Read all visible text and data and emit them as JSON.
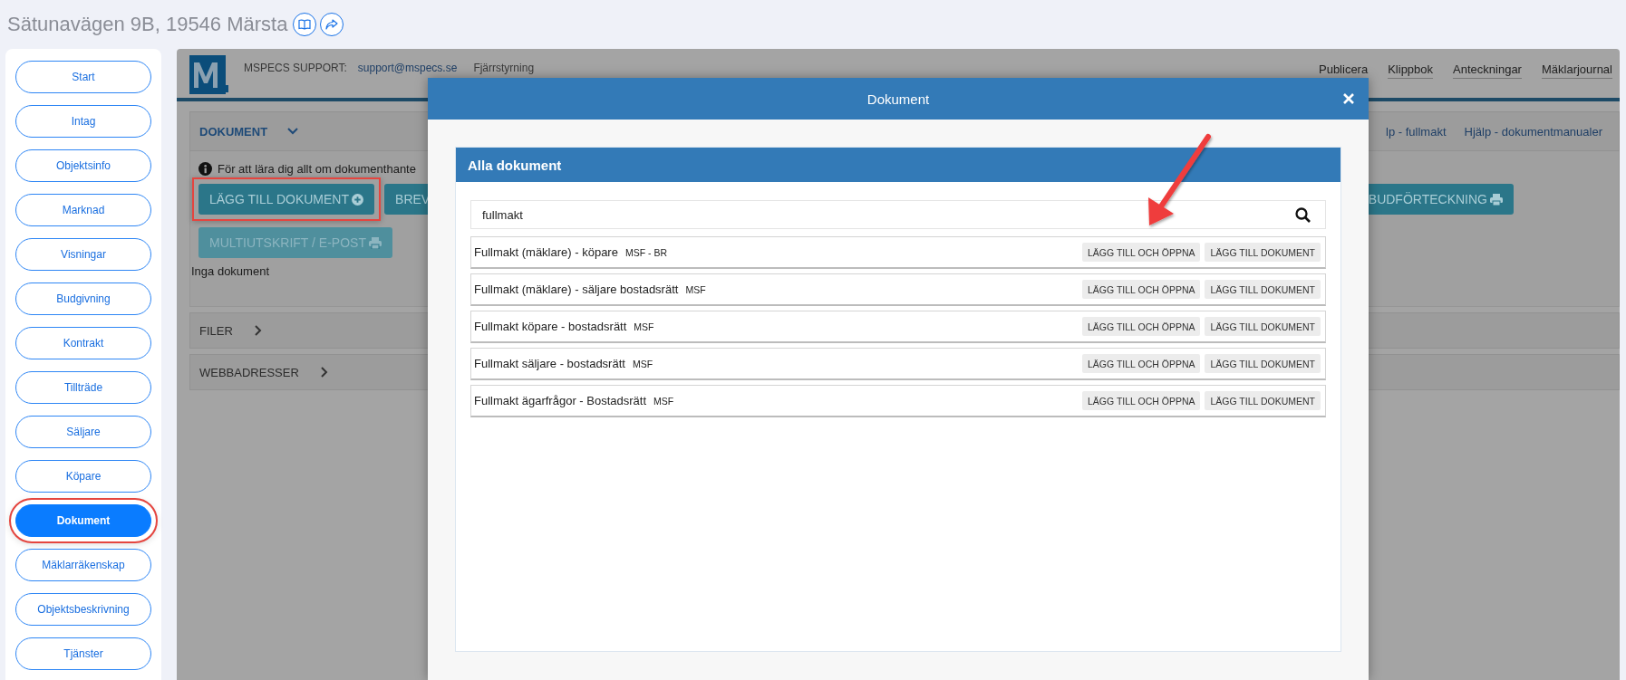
{
  "page_title": "Sätunavägen 9B, 19546 Märsta",
  "sidebar": {
    "items": [
      {
        "label": "Start",
        "selected": false,
        "highlighted": false
      },
      {
        "label": "Intag",
        "selected": false,
        "highlighted": false
      },
      {
        "label": "Objektsinfo",
        "selected": false,
        "highlighted": false
      },
      {
        "label": "Marknad",
        "selected": false,
        "highlighted": false
      },
      {
        "label": "Visningar",
        "selected": false,
        "highlighted": false
      },
      {
        "label": "Budgivning",
        "selected": false,
        "highlighted": false
      },
      {
        "label": "Kontrakt",
        "selected": false,
        "highlighted": false
      },
      {
        "label": "Tillträde",
        "selected": false,
        "highlighted": false
      },
      {
        "label": "Säljare",
        "selected": false,
        "highlighted": false
      },
      {
        "label": "Köpare",
        "selected": false,
        "highlighted": false
      },
      {
        "label": "Dokument",
        "selected": true,
        "highlighted": true
      },
      {
        "label": "Mäklarräkenskap",
        "selected": false,
        "highlighted": false
      },
      {
        "label": "Objektsbeskrivning",
        "selected": false,
        "highlighted": false
      },
      {
        "label": "Tjänster",
        "selected": false,
        "highlighted": false
      }
    ]
  },
  "app": {
    "support_label": "MSPECS SUPPORT:",
    "support_email": "support@mspecs.se",
    "remote_link": "Fjärrstyrning",
    "nav": [
      "Publicera",
      "Klippbok",
      "Anteckningar",
      "Mäklarjournal"
    ],
    "section": {
      "title": "DOKUMENT",
      "expanded": true,
      "help_links": [
        "lp - fullmakt",
        "Hjälp - dokumentmanualer"
      ],
      "info": "För att lära dig allt om dokumenthante",
      "toolbar_rows": [
        [
          {
            "label": "LÄGG TILL DOKUMENT",
            "kind": "add",
            "disabled": false,
            "highlighted": true
          },
          {
            "label": "BREV",
            "kind": "plain",
            "disabled": false,
            "highlighted": false
          },
          {
            "label": "BUDFÖRTECKNING",
            "kind": "print",
            "disabled": false,
            "highlighted": false
          }
        ],
        [
          {
            "label": "MULTIUTSKRIFT / E-POST",
            "kind": "print",
            "disabled": true,
            "highlighted": false
          }
        ]
      ],
      "empty_text": "Inga dokument"
    },
    "collapsed_sections": [
      {
        "title": "FILER",
        "expanded": false
      },
      {
        "title": "WEBBADRESSER",
        "expanded": false
      }
    ]
  },
  "modal": {
    "title": "Dokument",
    "panel_title": "Alla dokument",
    "search": {
      "value": "fullmakt"
    },
    "rows": [
      {
        "name": "Fullmakt (mäklare) - köpare",
        "tag": "MSF - BR",
        "actions": [
          "LÄGG TILL OCH ÖPPNA",
          "LÄGG TILL DOKUMENT"
        ]
      },
      {
        "name": "Fullmakt (mäklare) - säljare bostadsrätt",
        "tag": "MSF",
        "actions": [
          "LÄGG TILL OCH ÖPPNA",
          "LÄGG TILL DOKUMENT"
        ]
      },
      {
        "name": "Fullmakt köpare - bostadsrätt",
        "tag": "MSF",
        "actions": [
          "LÄGG TILL OCH ÖPPNA",
          "LÄGG TILL DOKUMENT"
        ]
      },
      {
        "name": "Fullmakt säljare - bostadsrätt",
        "tag": "MSF",
        "actions": [
          "LÄGG TILL OCH ÖPPNA",
          "LÄGG TILL DOKUMENT"
        ]
      },
      {
        "name": "Fullmakt ägarfrågor - Bostadsrätt",
        "tag": "MSF",
        "actions": [
          "LÄGG TILL OCH ÖPPNA",
          "LÄGG TILL DOKUMENT"
        ]
      }
    ]
  }
}
